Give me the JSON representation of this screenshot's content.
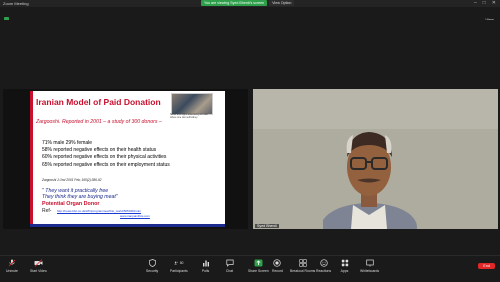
{
  "window": {
    "title": "Zoom Meeting",
    "controls": [
      "–",
      "□",
      "✕"
    ]
  },
  "share_banner": {
    "message": "You are viewing Syed Bherdi's screen",
    "options_label": "View Option"
  },
  "topbar": {
    "view_label": "View"
  },
  "slide": {
    "title": "Iranian Model of Paid Donation",
    "photo_caption": "Notes and signs advertising for sale where one can sell kidney",
    "subtitle": "Zargooshi.  Reported in 2001 – a study of  300 donors –",
    "stats": [
      "71% male 29% female",
      "58% reported negative effects on their health status",
      "60% reported negative effects on their physical activities",
      "65% reported negative effects on their employment status"
    ],
    "citation": "Zargooshi J Urol 2001 Feb; 165(2):386-92",
    "quote_lines": [
      "\" They want it practically free",
      "They think they are buying meat\""
    ],
    "potential_donor": "Potential Organ Donor",
    "ref_label": "Ref-",
    "link1": "http://news.bbc.co.uk/2/hi/programmes/this_world/5050460.stm",
    "link2": "www.iranpainthits.com"
  },
  "participants": {
    "screen_owner_name": "Syed Bherdi",
    "camera_name": "Syed Bherdi"
  },
  "toolbar": {
    "items": [
      {
        "label": "Unmute",
        "icon": "microphone-muted-icon"
      },
      {
        "label": "Start Video",
        "icon": "video-off-icon"
      },
      {
        "label": "Security",
        "icon": "shield-icon"
      },
      {
        "label": "Participants",
        "icon": "participants-icon",
        "count": "80"
      },
      {
        "label": "Polls",
        "icon": "polls-icon"
      },
      {
        "label": "Chat",
        "icon": "chat-icon"
      },
      {
        "label": "Share Screen",
        "icon": "share-screen-icon"
      },
      {
        "label": "Record",
        "icon": "record-icon"
      },
      {
        "label": "Breakout Rooms",
        "icon": "breakout-rooms-icon"
      },
      {
        "label": "Reactions",
        "icon": "reactions-icon"
      },
      {
        "label": "Apps",
        "icon": "apps-icon"
      },
      {
        "label": "Whiteboards",
        "icon": "whiteboard-icon"
      }
    ],
    "end_label": "End"
  },
  "colors": {
    "accent": "#2e9f4a",
    "end": "#e02828",
    "slide_red": "#c8102e",
    "slide_blue": "#1b2a8c"
  }
}
